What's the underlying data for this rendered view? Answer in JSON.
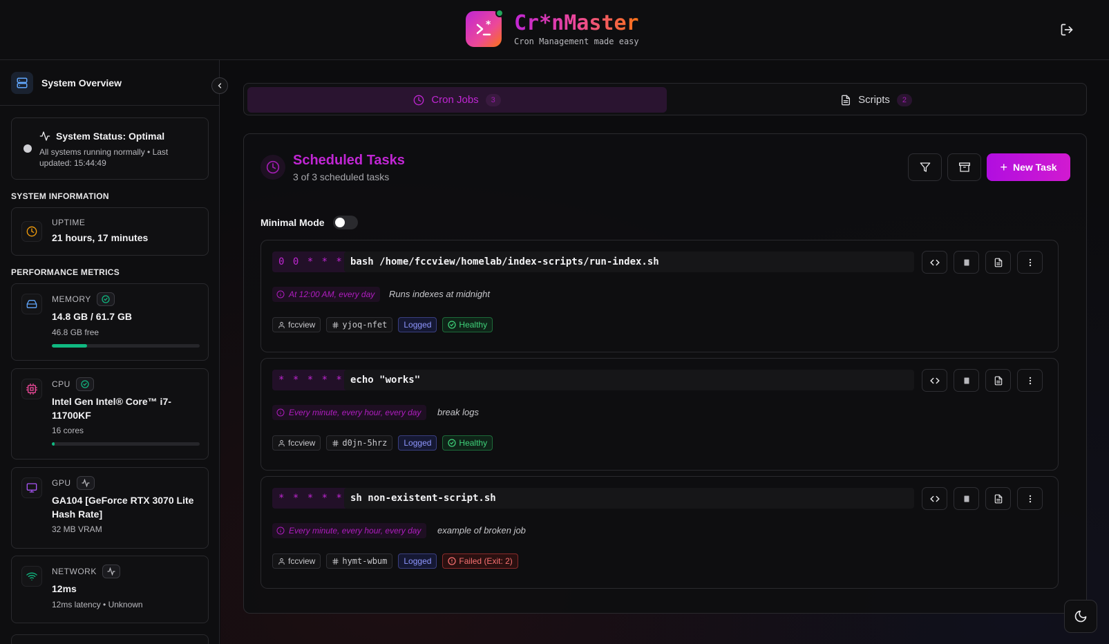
{
  "header": {
    "title": "Cr*nMaster",
    "subtitle": "Cron Management made easy",
    "logo_icon": "terminal-asterisk-icon",
    "logout_icon": "logout-icon"
  },
  "sidebar": {
    "title": "System Overview",
    "status": {
      "title": "System Status: Optimal",
      "description": "All systems running normally • Last updated: 15:44:49"
    },
    "system_info_label": "SYSTEM INFORMATION",
    "uptime": {
      "label": "UPTIME",
      "value": "21 hours, 17 minutes"
    },
    "performance_label": "PERFORMANCE METRICS",
    "memory": {
      "label": "MEMORY",
      "value": "14.8 GB / 61.7 GB",
      "sub": "46.8 GB free",
      "usage_percent": 24
    },
    "cpu": {
      "label": "CPU",
      "value": "Intel Gen Intel® Core™ i7-11700KF",
      "sub": "16 cores",
      "usage_percent": 2
    },
    "gpu": {
      "label": "GPU",
      "value": "GA104 [GeForce RTX 3070 Lite Hash Rate]",
      "sub": "32 MB VRAM"
    },
    "network": {
      "label": "NETWORK",
      "value": "12ms",
      "sub": "12ms latency • Unknown"
    }
  },
  "tabs": [
    {
      "label": "Cron Jobs",
      "count": "3",
      "active": true
    },
    {
      "label": "Scripts",
      "count": "2",
      "active": false
    }
  ],
  "panel": {
    "title": "Scheduled Tasks",
    "subtitle": "3 of 3 scheduled tasks",
    "new_task_label": "New Task",
    "minimal_mode_label": "Minimal Mode",
    "minimal_mode_on": false
  },
  "jobs": [
    {
      "schedule": "0 0 * * *",
      "command": "bash /home/fccview/homelab/index-scripts/run-index.sh",
      "human": "At 12:00 AM, every day",
      "description": "Runs indexes at midnight",
      "user": "fccview",
      "id": "yjoq-nfet",
      "logged": "Logged",
      "status": "Healthy"
    },
    {
      "schedule": "* * * * *",
      "command": "echo \"works\"",
      "human": "Every minute, every hour, every day",
      "description": "break logs",
      "user": "fccview",
      "id": "d0jn-5hrz",
      "logged": "Logged",
      "status": "Healthy"
    },
    {
      "schedule": "* * * * *",
      "command": "sh non-existent-script.sh",
      "human": "Every minute, every hour, every day",
      "description": "example of broken job",
      "user": "fccview",
      "id": "hymt-wbum",
      "logged": "Logged",
      "status": "Failed (Exit: 2)"
    }
  ],
  "colors": {
    "accent": "#c026d3",
    "healthy": "#3fd27a",
    "failed": "#f87171",
    "logged": "#8f97ff"
  }
}
